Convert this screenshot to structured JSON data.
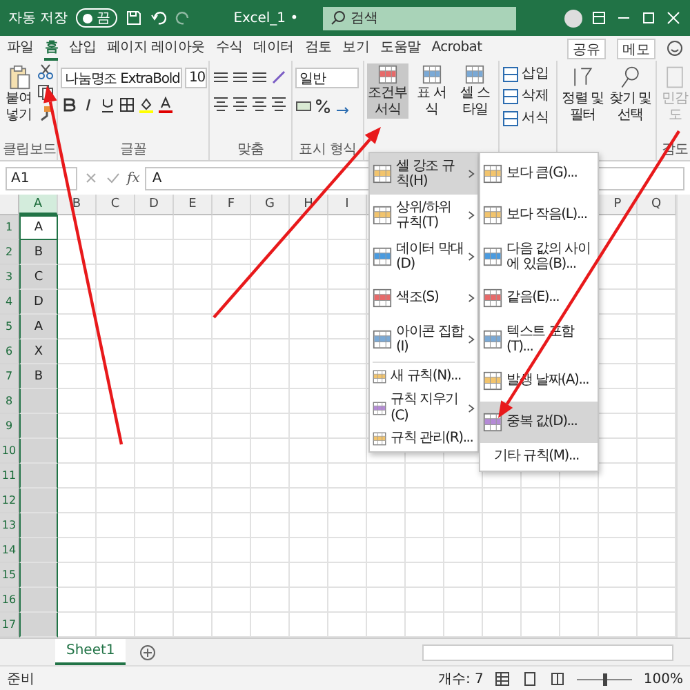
{
  "title_bar": {
    "autosave_label": "자동 저장",
    "autosave": {
      "on": false,
      "state": "끔"
    },
    "file_name": "Excel_1 •",
    "search": {
      "placeholder": "검색"
    }
  },
  "tabs": [
    {
      "label": "파일",
      "selected": false
    },
    {
      "label": "홈",
      "selected": true
    },
    {
      "label": "삽입",
      "selected": false
    },
    {
      "label": "페이지 레이아웃",
      "selected": false
    },
    {
      "label": "수식",
      "selected": false
    },
    {
      "label": "데이터",
      "selected": false
    },
    {
      "label": "검토",
      "selected": false
    },
    {
      "label": "보기",
      "selected": false
    },
    {
      "label": "도움말",
      "selected": false
    },
    {
      "label": "Acrobat",
      "selected": false
    }
  ],
  "tab_actions": [
    "공유",
    "메모"
  ],
  "ribbon": {
    "clipboard": {
      "paste": "붙여넣기",
      "label": "클립보드"
    },
    "font": {
      "name": "나눔명조 ExtraBold",
      "size": "10",
      "label": "글꼴"
    },
    "alignment": {
      "label": "맞춤"
    },
    "number": {
      "format": "일반",
      "label": "표시 형식"
    },
    "styles": [
      {
        "label": "조건부 서식",
        "selected": true
      },
      {
        "label": "표 서식",
        "selected": false
      },
      {
        "label": "셀 스타일",
        "selected": false
      }
    ],
    "cells": [
      "삽입",
      "삭제",
      "서식"
    ],
    "editing": [
      "정렬 및 필터",
      "찾기 및 선택"
    ],
    "sensitivity": {
      "button": "민감도",
      "disabled": true,
      "label": "감도"
    }
  },
  "formula_bar": {
    "name_box": "A1",
    "fx": "fx",
    "value": "A"
  },
  "sheet": {
    "columns_left": [
      {
        "label": "A",
        "selected": true
      },
      {
        "label": "B",
        "selected": false
      },
      {
        "label": "C",
        "selected": false
      },
      {
        "label": "D",
        "selected": false
      },
      {
        "label": "E",
        "selected": false
      },
      {
        "label": "F",
        "selected": false
      },
      {
        "label": "G",
        "selected": false
      },
      {
        "label": "H",
        "selected": false
      },
      {
        "label": "I",
        "selected": false
      }
    ],
    "columns_right": [
      {
        "label": "P",
        "selected": false
      },
      {
        "label": "Q",
        "selected": false
      }
    ],
    "rows": [
      {
        "label": "1",
        "value": "A"
      },
      {
        "label": "2",
        "value": "B"
      },
      {
        "label": "3",
        "value": "C"
      },
      {
        "label": "4",
        "value": "D"
      },
      {
        "label": "5",
        "value": "A"
      },
      {
        "label": "6",
        "value": "X"
      },
      {
        "label": "7",
        "value": "B"
      },
      {
        "label": "8"
      },
      {
        "label": "9"
      },
      {
        "label": "10"
      },
      {
        "label": "11"
      },
      {
        "label": "12"
      },
      {
        "label": "13"
      },
      {
        "label": "14"
      },
      {
        "label": "15"
      },
      {
        "label": "16"
      },
      {
        "label": "17"
      }
    ]
  },
  "sheet_tabs": [
    {
      "label": "Sheet1",
      "selected": true
    }
  ],
  "status_bar": {
    "ready": "준비",
    "count": "개수: 7",
    "zoom": {
      "level": 0.5,
      "reading": "100%"
    }
  },
  "conditional_menu": [
    {
      "label": "셀 강조 규칙(H)",
      "submenu": true,
      "selected": true,
      "kind": "large"
    },
    {
      "label": "상위/하위 규칙(T)",
      "submenu": true,
      "selected": false,
      "kind": "large"
    },
    {
      "label": "데이터 막대(D)",
      "submenu": true,
      "selected": false,
      "kind": "large"
    },
    {
      "label": "색조(S)",
      "submenu": true,
      "selected": false,
      "kind": "large"
    },
    {
      "label": "아이콘 집합(I)",
      "submenu": true,
      "selected": false,
      "kind": "large"
    },
    {
      "label": "새 규칙(N)...",
      "submenu": false,
      "selected": false,
      "kind": "small"
    },
    {
      "label": "규칙 지우기(C)",
      "submenu": true,
      "selected": false,
      "kind": "small"
    },
    {
      "label": "규칙 관리(R)...",
      "submenu": false,
      "selected": false,
      "kind": "small"
    }
  ],
  "highlight_submenu": [
    {
      "label": "보다 큼(G)...",
      "selected": false,
      "kind": "large"
    },
    {
      "label": "보다 작음(L)...",
      "selected": false,
      "kind": "large"
    },
    {
      "label": "다음 값의 사이에 있음(B)...",
      "selected": false,
      "kind": "large"
    },
    {
      "label": "같음(E)...",
      "selected": false,
      "kind": "large"
    },
    {
      "label": "텍스트 포함(T)...",
      "selected": false,
      "kind": "large"
    },
    {
      "label": "발생 날짜(A)...",
      "selected": false,
      "kind": "large"
    },
    {
      "label": "중복 값(D)...",
      "selected": true,
      "kind": "large"
    },
    {
      "label": "기타 규칙(M)...",
      "selected": false,
      "kind": "plain"
    }
  ]
}
